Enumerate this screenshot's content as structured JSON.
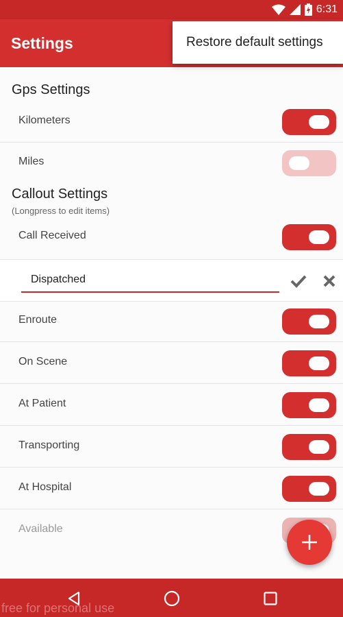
{
  "status_bar": {
    "time": "6:31",
    "icons": [
      "wifi-icon",
      "signal-icon",
      "battery-icon"
    ]
  },
  "app_bar": {
    "title": "Settings"
  },
  "overflow_menu": {
    "items": [
      {
        "label": "Restore default settings"
      }
    ]
  },
  "gps": {
    "title": "Gps Settings",
    "items": [
      {
        "label": "Kilometers",
        "on": true
      },
      {
        "label": "Miles",
        "on": false
      }
    ]
  },
  "callout": {
    "title": "Callout Settings",
    "subtitle": "(Longpress to edit items)",
    "items": [
      {
        "label": "Call Received",
        "on": true
      },
      {
        "label": "Enroute",
        "on": true
      },
      {
        "label": "On Scene",
        "on": true
      },
      {
        "label": "At Patient",
        "on": true
      },
      {
        "label": "Transporting",
        "on": true
      },
      {
        "label": "At Hospital",
        "on": true
      },
      {
        "label": "Available",
        "on": true
      }
    ],
    "editing": {
      "value": "Dispatched"
    }
  },
  "fab": {
    "icon": "plus-icon"
  },
  "nav_bar": {
    "buttons": [
      "back-icon",
      "home-icon",
      "recents-icon"
    ],
    "watermark": "free for personal use"
  },
  "colors": {
    "primary": "#d32f2f",
    "status": "#c62828",
    "fab": "#e53935",
    "switch_off": "#f2c4c4"
  }
}
